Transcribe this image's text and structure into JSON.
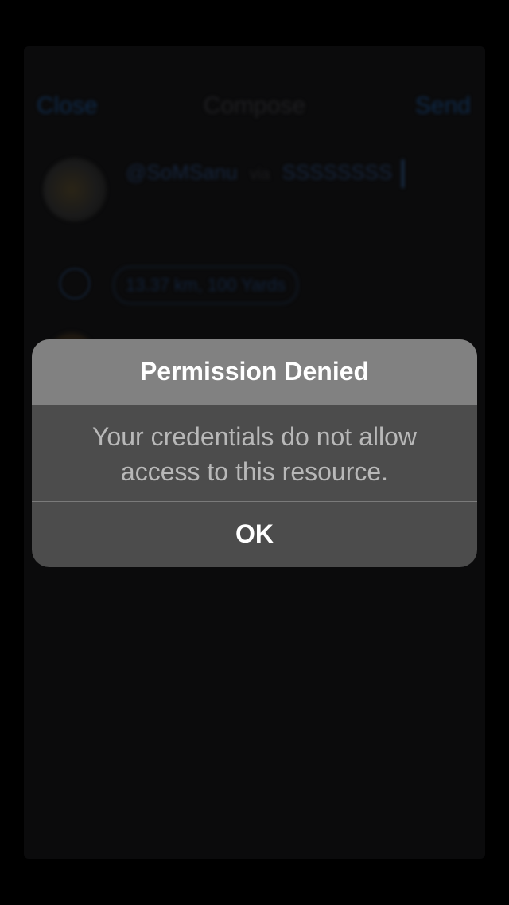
{
  "background": {
    "nav": {
      "left_button": "Close",
      "title": "Compose",
      "right_button": "Send"
    },
    "account": {
      "name": "@SoMSanu",
      "via": "via",
      "service": "SSSSSSSS"
    },
    "location": {
      "text": "13.37 km, 100 Yards"
    },
    "icons": {
      "avatar": "avatar",
      "location": "location-pin-icon"
    }
  },
  "alert": {
    "title": "Permission Denied",
    "message": "Your credentials do not allow access to this resource.",
    "button": "OK"
  },
  "colors": {
    "screen_background": "#000000",
    "alert_header": "#818181",
    "alert_body": "#4c4c4c",
    "alert_message_text": "#b8b8b8",
    "alert_title_text": "#ffffff"
  }
}
